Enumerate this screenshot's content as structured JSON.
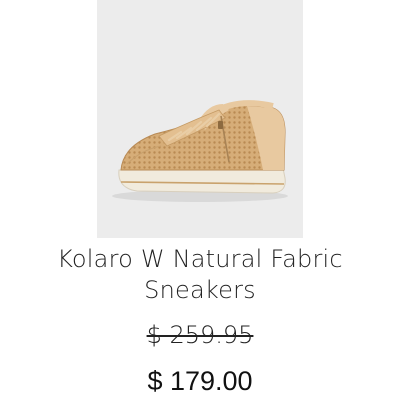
{
  "product": {
    "title_line1": "Kolaro W Natural Fabric",
    "title_line2": "Sneakers",
    "original_price": "$ 259.95",
    "sale_price": "$ 179.00",
    "image_icon": "sneaker-photo",
    "colors": {
      "image_background": "#ececec",
      "shoe_upper": "#d8b07c",
      "shoe_sole": "#f1ebdd"
    }
  }
}
